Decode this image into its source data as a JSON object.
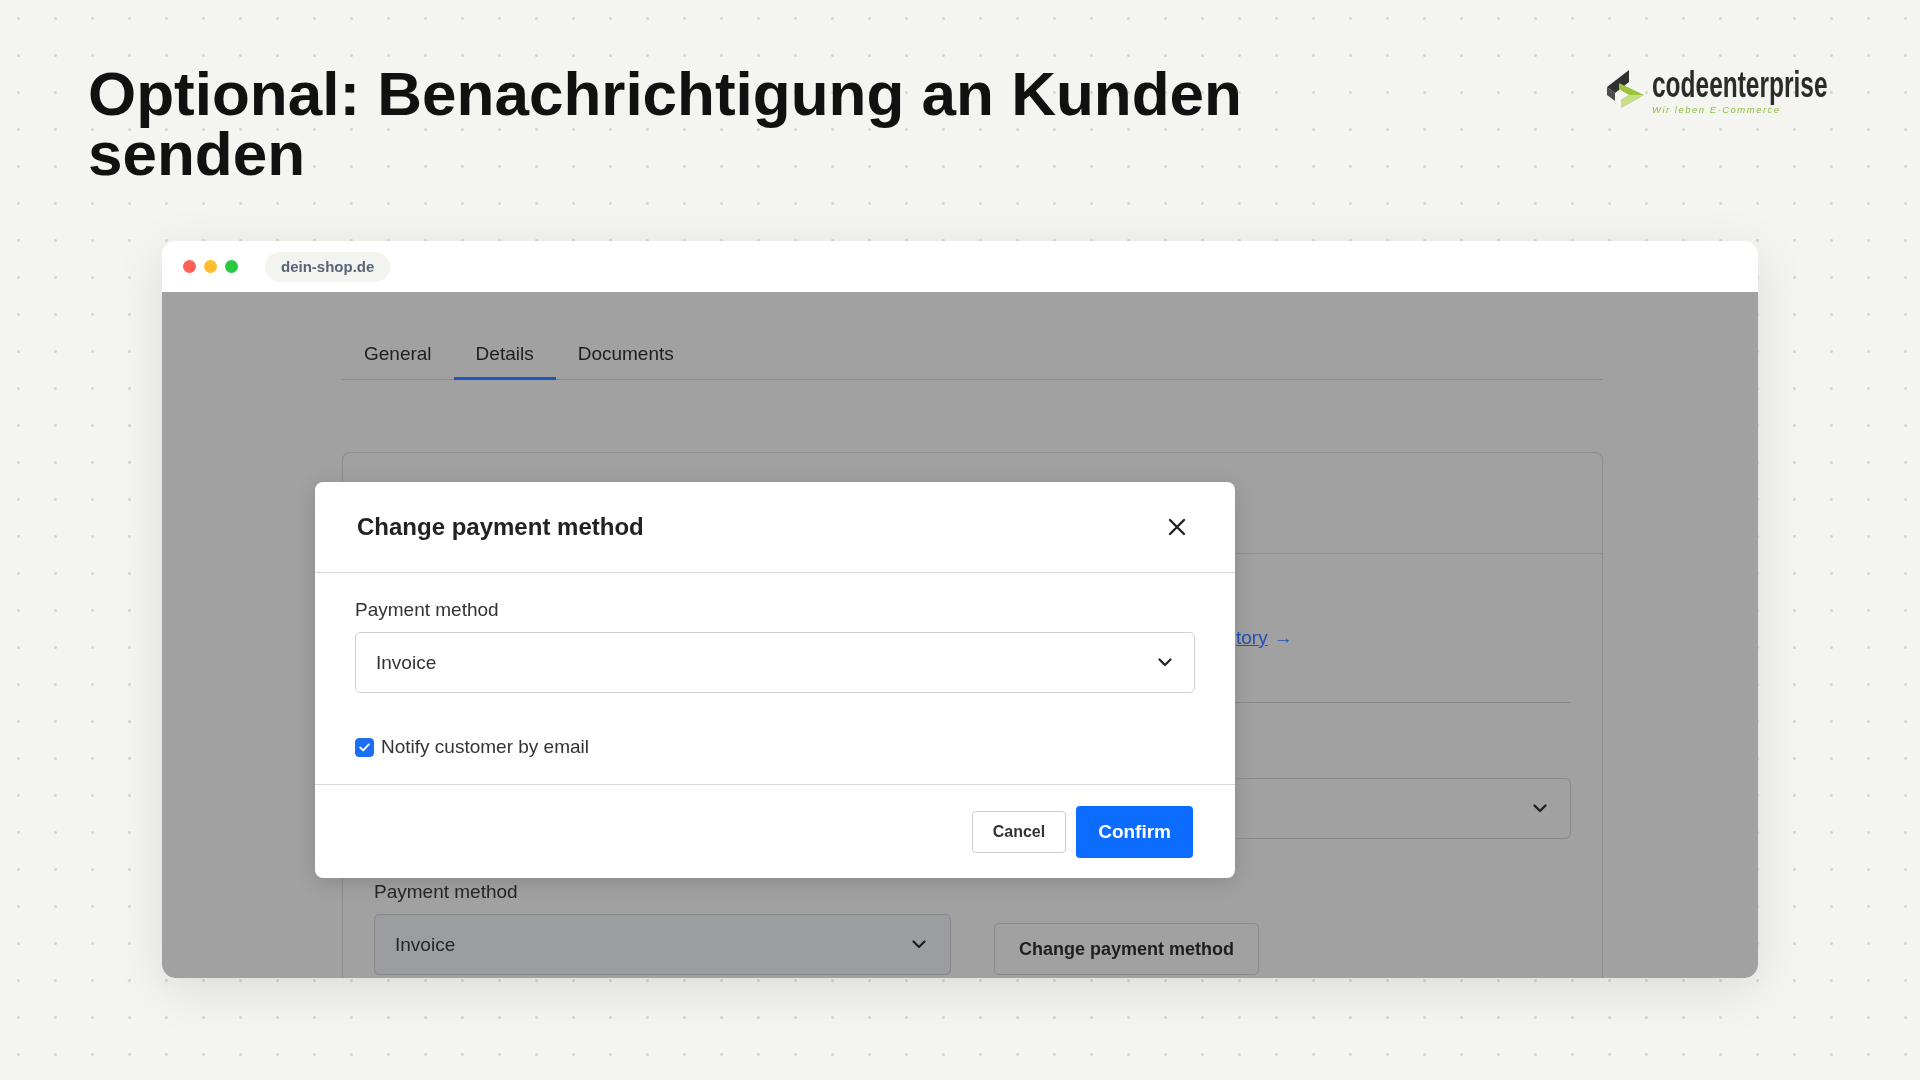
{
  "title": "Optional: Benachrichtigung an Kunden senden",
  "logo": {
    "wordmark": "codeenterprise",
    "tagline": "Wir leben E-Commerce"
  },
  "browser": {
    "url": "dein-shop.de"
  },
  "tabs": [
    {
      "label": "General",
      "selected": false
    },
    {
      "label": "Details",
      "selected": true
    },
    {
      "label": "Documents",
      "selected": false
    }
  ],
  "order_details": {
    "link": {
      "text": "tory",
      "arrow": "→"
    },
    "payment_label": "Payment method",
    "payment_value": "Invoice",
    "change_button": "Change payment method"
  },
  "modal": {
    "title": "Change payment method",
    "field_label": "Payment method",
    "field_value": "Invoice",
    "notify": {
      "label": "Notify customer by email",
      "checked": true
    },
    "buttons": [
      {
        "label": "Cancel",
        "kind": "secondary"
      },
      {
        "label": "Confirm",
        "kind": "primary"
      }
    ]
  }
}
